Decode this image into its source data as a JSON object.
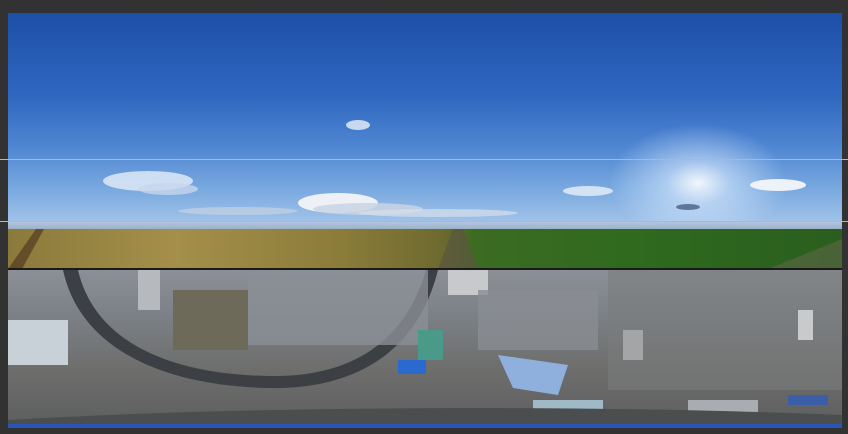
{
  "canvas": {
    "content": "panorama-image",
    "guides_color": "#3fe5ff",
    "background_color": "#323232"
  }
}
